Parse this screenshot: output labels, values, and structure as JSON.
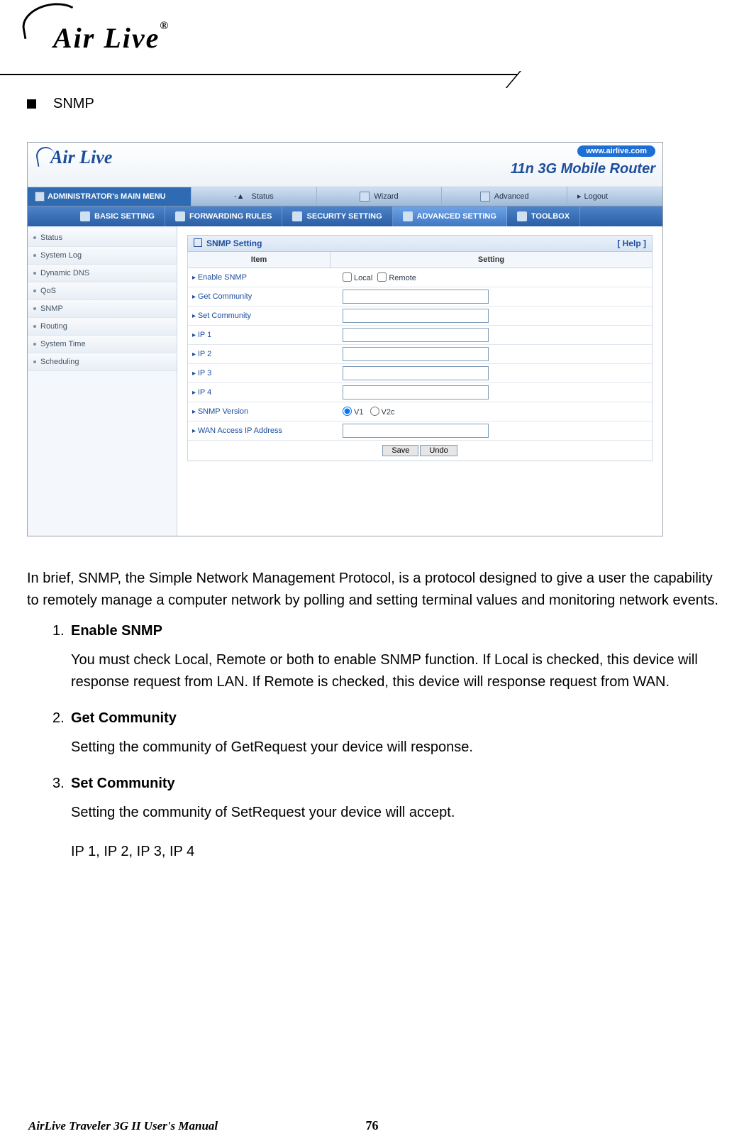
{
  "doc_logo_text": "Air Live",
  "doc_logo_reg": "®",
  "section_bullet_title": "SNMP",
  "shot": {
    "logo_text": "Air Live",
    "url_pill": "www.airlive.com",
    "model": "11n 3G Mobile Router",
    "menubar": {
      "lead": "ADMINISTRATOR's MAIN MENU",
      "tabs": [
        "Status",
        "Wizard",
        "Advanced"
      ],
      "logout": "Logout"
    },
    "toolbar": [
      "BASIC SETTING",
      "FORWARDING RULES",
      "SECURITY SETTING",
      "ADVANCED SETTING",
      "TOOLBOX"
    ],
    "toolbar_active_index": 3,
    "sidebar": [
      "Status",
      "System Log",
      "Dynamic DNS",
      "QoS",
      "SNMP",
      "Routing",
      "System Time",
      "Scheduling"
    ],
    "panel_title": "SNMP Setting",
    "help": "[ Help ]",
    "col_item": "Item",
    "col_setting": "Setting",
    "rows": {
      "enable": {
        "label": "Enable SNMP",
        "local": "Local",
        "remote": "Remote"
      },
      "get": {
        "label": "Get Community",
        "value": ""
      },
      "set": {
        "label": "Set Community",
        "value": ""
      },
      "ip1": {
        "label": "IP 1",
        "value": ""
      },
      "ip2": {
        "label": "IP 2",
        "value": ""
      },
      "ip3": {
        "label": "IP 3",
        "value": ""
      },
      "ip4": {
        "label": "IP 4",
        "value": ""
      },
      "ver": {
        "label": "SNMP Version",
        "v1": "V1",
        "v2c": "V2c"
      },
      "wan": {
        "label": "WAN Access IP Address",
        "value": ""
      }
    },
    "save_btn": "Save",
    "undo_btn": "Undo"
  },
  "para_intro": "In brief, SNMP, the Simple Network Management Protocol, is a protocol designed to give a user the capability to remotely manage a computer network by polling and setting terminal values and monitoring network events.",
  "list": [
    {
      "n": "1.",
      "title": "Enable SNMP",
      "body": "You must check Local, Remote or both to enable SNMP function. If Local is checked, this device will response request from LAN. If Remote is checked, this device will response request from WAN."
    },
    {
      "n": "2.",
      "title": "Get Community",
      "body": "Setting the community of GetRequest your device will response."
    },
    {
      "n": "3.",
      "title": "Set Community",
      "body": "Setting the community of SetRequest your device will accept.",
      "extra": "IP 1, IP 2, IP 3, IP 4"
    }
  ],
  "page_number": "76",
  "footer_left": "AirLive Traveler 3G II User's Manual"
}
